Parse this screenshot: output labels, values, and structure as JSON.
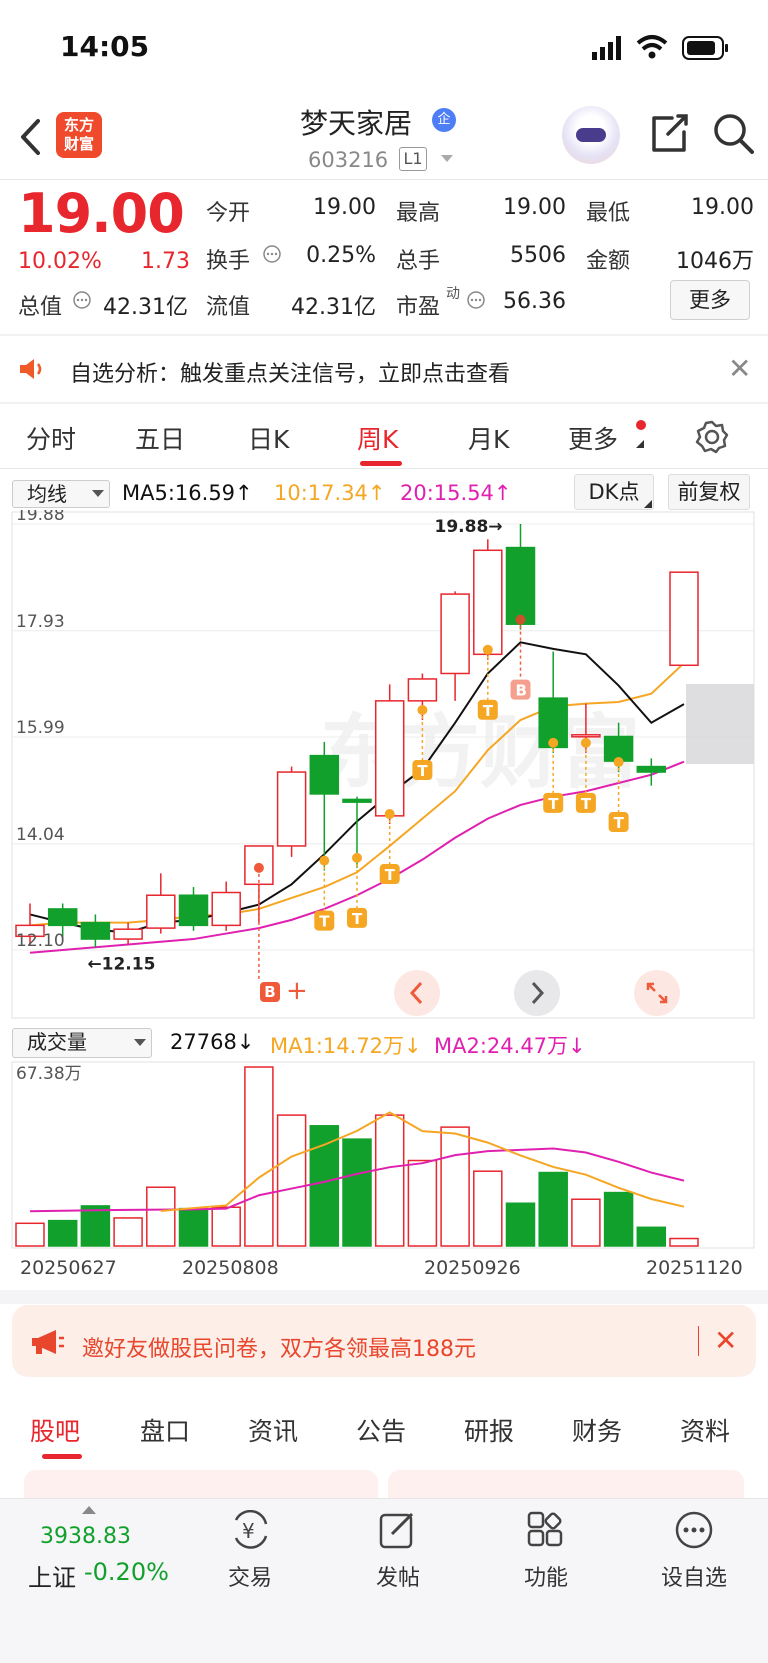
{
  "status_bar": {
    "time": "14:05"
  },
  "header": {
    "logo_text_1": "东方",
    "logo_text_2": "财富",
    "stock_name": "梦天家居",
    "badge": "企",
    "stock_code": "603216",
    "level": "L1"
  },
  "quote": {
    "price": "19.00",
    "change_pct": "10.02%",
    "change_amt": "1.73",
    "open_label": "今开",
    "open": "19.00",
    "high_label": "最高",
    "high": "19.00",
    "low_label": "最低",
    "low": "19.00",
    "turnover_label": "换手",
    "turnover": "0.25%",
    "volume_label": "总手",
    "volume": "5506",
    "amount_label": "金额",
    "amount": "1046万",
    "mktcap_label": "总值",
    "mktcap": "42.31亿",
    "float_label": "流值",
    "float": "42.31亿",
    "pe_label": "市盈",
    "pe_sup": "动",
    "pe": "56.36",
    "more": "更多"
  },
  "notice": {
    "text": "自选分析：触发重点关注信号，立即点击查看"
  },
  "chart_tabs": [
    "分时",
    "五日",
    "日K",
    "周K",
    "月K",
    "更多"
  ],
  "active_tab": "周K",
  "ma_bar": {
    "select": "均线",
    "ma5": "MA5:16.59↑",
    "ma10": "10:17.34↑",
    "ma20": "20:15.54↑",
    "dk": "DK点",
    "fq": "前复权"
  },
  "volume_bar": {
    "select": "成交量",
    "vol": "27768↓",
    "ma1": "MA1:14.72万↓",
    "ma2": "MA2:24.47万↓",
    "top_label": "67.38万"
  },
  "colors": {
    "up": "#e8262d",
    "down": "#12a02c",
    "ma5": "#111111",
    "ma10": "#f5a623",
    "ma20": "#e020b0"
  },
  "chart_data": {
    "type": "candlestick",
    "y_ticks": [
      "19.88",
      "17.93",
      "15.99",
      "14.04",
      "12.10"
    ],
    "ylim": [
      12.1,
      19.88
    ],
    "annotations": {
      "max": "19.88→",
      "min": "←12.15"
    },
    "x_tick_labels": [
      "20250627",
      "20250808",
      "20250926",
      "20251120"
    ],
    "candles": [
      {
        "o": 12.35,
        "c": 12.55,
        "h": 12.95,
        "l": 12.2
      },
      {
        "o": 12.85,
        "c": 12.55,
        "h": 12.95,
        "l": 12.3
      },
      {
        "o": 12.6,
        "c": 12.3,
        "h": 12.75,
        "l": 12.15
      },
      {
        "o": 12.3,
        "c": 12.48,
        "h": 12.6,
        "l": 12.2
      },
      {
        "o": 12.5,
        "c": 13.1,
        "h": 13.5,
        "l": 12.4
      },
      {
        "o": 13.1,
        "c": 12.55,
        "h": 13.25,
        "l": 12.45
      },
      {
        "o": 12.55,
        "c": 13.15,
        "h": 13.35,
        "l": 12.45
      },
      {
        "o": 13.3,
        "c": 14.0,
        "h": 14.0,
        "l": 12.6
      },
      {
        "o": 14.0,
        "c": 15.35,
        "h": 15.45,
        "l": 13.8
      },
      {
        "o": 15.65,
        "c": 14.95,
        "h": 15.9,
        "l": 13.55
      },
      {
        "o": 14.85,
        "c": 14.8,
        "h": 14.9,
        "l": 13.6
      },
      {
        "o": 14.55,
        "c": 16.65,
        "h": 16.95,
        "l": 14.4
      },
      {
        "o": 16.65,
        "c": 17.05,
        "h": 17.15,
        "l": 16.3
      },
      {
        "o": 17.15,
        "c": 18.6,
        "h": 18.65,
        "l": 16.65
      },
      {
        "o": 17.5,
        "c": 19.4,
        "h": 19.6,
        "l": 17.4
      },
      {
        "o": 19.45,
        "c": 18.05,
        "h": 19.88,
        "l": 17.95
      },
      {
        "o": 16.7,
        "c": 15.8,
        "h": 17.55,
        "l": 15.7
      },
      {
        "o": 16.0,
        "c": 16.03,
        "h": 16.6,
        "l": 15.7
      },
      {
        "o": 16.0,
        "c": 15.55,
        "h": 16.25,
        "l": 15.35
      },
      {
        "o": 15.45,
        "c": 15.35,
        "h": 15.6,
        "l": 15.1
      },
      {
        "o": 17.3,
        "c": 19.0,
        "h": 19.0,
        "l": 17.3
      }
    ],
    "ma5": [
      12.75,
      12.6,
      12.47,
      12.42,
      12.6,
      12.65,
      12.78,
      12.93,
      13.3,
      13.85,
      14.45,
      14.95,
      15.4,
      16.25,
      17.15,
      17.72,
      17.6,
      17.5,
      16.93,
      16.25,
      16.59
    ],
    "ma10": [
      12.55,
      12.6,
      12.6,
      12.6,
      12.65,
      12.72,
      12.75,
      12.85,
      13.05,
      13.25,
      13.52,
      14.0,
      14.5,
      15.0,
      15.75,
      16.3,
      16.55,
      16.6,
      16.63,
      16.78,
      17.34
    ],
    "ma20": [
      12.05,
      12.1,
      12.15,
      12.2,
      12.25,
      12.3,
      12.4,
      12.5,
      12.65,
      12.85,
      13.1,
      13.4,
      13.75,
      14.15,
      14.5,
      14.75,
      14.9,
      15.0,
      15.15,
      15.3,
      15.54
    ],
    "volume": {
      "max": 67.38,
      "values": [
        8.5,
        9.5,
        15.0,
        10.5,
        22.0,
        14.0,
        14.5,
        67.0,
        49.0,
        45.0,
        40.0,
        49.0,
        32.0,
        44.5,
        28.0,
        16.0,
        27.5,
        17.5,
        20.0,
        7.0,
        2.8
      ],
      "ma1": [
        null,
        null,
        null,
        null,
        13.1,
        14.2,
        15.2,
        25.6,
        33.5,
        37.9,
        43.1,
        50.0,
        43.0,
        42.1,
        38.7,
        33.9,
        29.6,
        26.7,
        21.8,
        17.6,
        14.72
      ],
      "ma2": [
        13.0,
        13.2,
        13.4,
        13.5,
        13.6,
        13.7,
        14.0,
        19.0,
        21.5,
        24.0,
        27.0,
        29.5,
        31.0,
        34.0,
        35.5,
        36.0,
        36.5,
        35.0,
        31.5,
        27.5,
        24.47
      ]
    }
  },
  "promo": {
    "text": "邀好友做股民问卷，双方各领最高188元"
  },
  "bottom_tabs": [
    "股吧",
    "盘口",
    "资讯",
    "公告",
    "研报",
    "财务",
    "资料"
  ],
  "bottom_active": "股吧",
  "bottom_nav": {
    "index_value": "3938.83",
    "index_name": "上证",
    "index_change": "-0.20%",
    "items": [
      "交易",
      "发帖",
      "功能",
      "设自选"
    ]
  }
}
